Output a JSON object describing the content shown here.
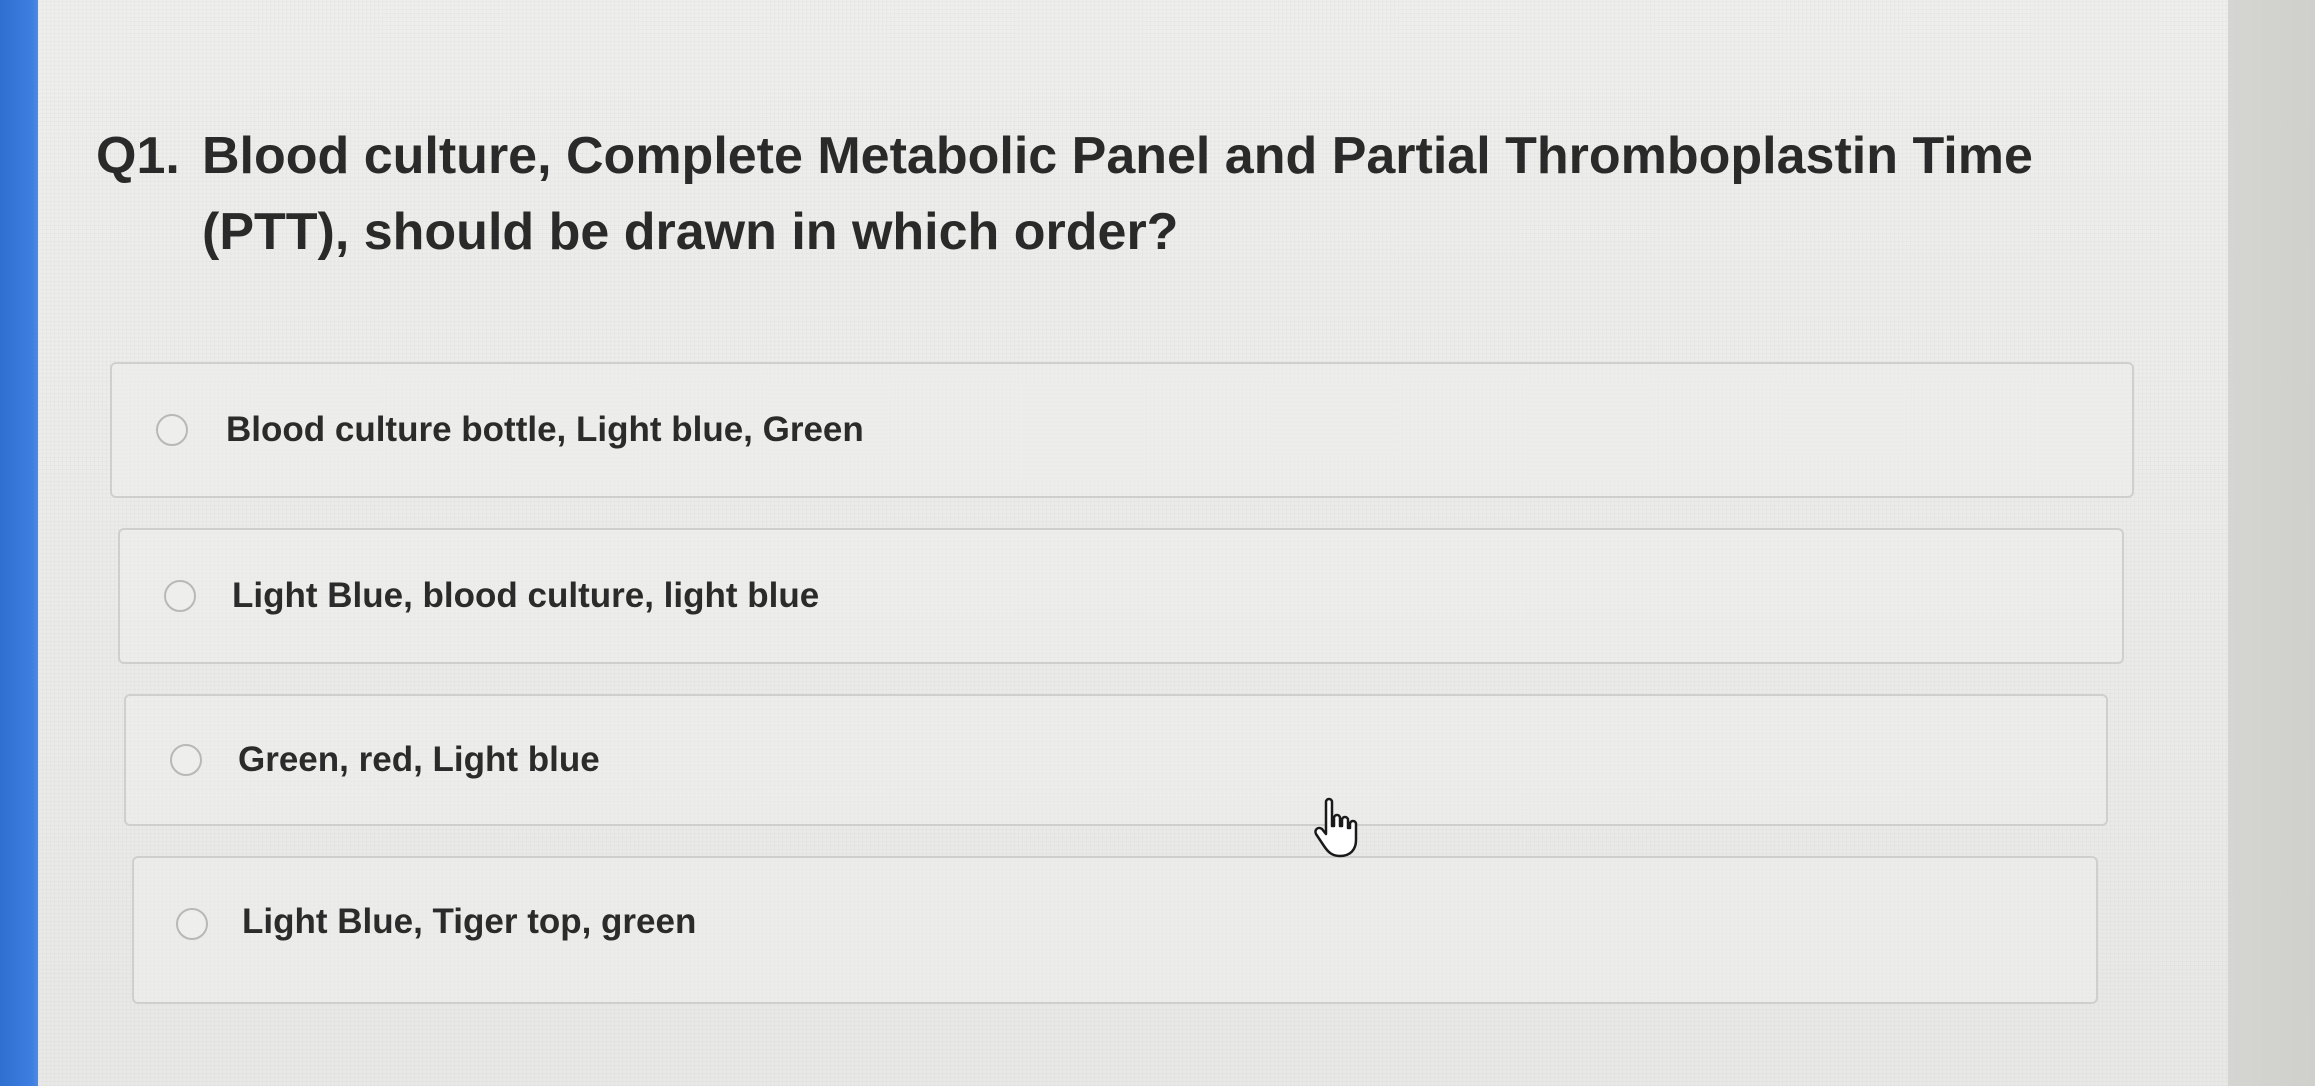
{
  "question": {
    "number": "Q1.",
    "text": "Blood culture, Complete Metabolic Panel and Partial Thromboplastin Time (PTT), should be drawn in which order?"
  },
  "options": [
    {
      "label": "Blood culture bottle, Light blue, Green",
      "selected": false
    },
    {
      "label": "Light Blue, blood culture, light blue",
      "selected": false
    },
    {
      "label": "Green, red, Light blue",
      "selected": false
    },
    {
      "label": "Light Blue, Tiger top, green",
      "selected": false
    }
  ],
  "icons": {
    "radio": "radio-button-empty",
    "cursor": "hand-pointer-icon"
  },
  "colors": {
    "background": "#ebebe9",
    "text": "#2a2a2a",
    "option_border": "#cfcfcd",
    "left_bar": "#3d7ee0"
  }
}
